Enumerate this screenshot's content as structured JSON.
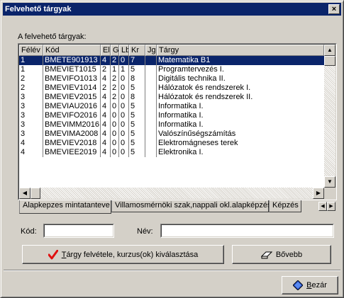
{
  "window": {
    "title": "Felvehető tárgyak",
    "close_glyph": "×"
  },
  "list_label": "A felvehető tárgyak:",
  "table": {
    "columns": [
      "Félév",
      "Kód",
      "El",
      "Gy",
      "Lb",
      "Kr",
      "Jg.",
      "Tárgy"
    ],
    "selected_row": 0,
    "rows": [
      [
        "1",
        "BMETE901913",
        "4",
        "2",
        "0",
        "7",
        "",
        "Matematika B1"
      ],
      [
        "1",
        "BMEVIET1015",
        "2",
        "1",
        "1",
        "5",
        "",
        "Programtervezés I."
      ],
      [
        "2",
        "BMEVIFO1013",
        "4",
        "2",
        "0",
        "8",
        "",
        "Digitális technika II."
      ],
      [
        "2",
        "BMEVIEV1014",
        "2",
        "2",
        "0",
        "5",
        "",
        "Hálózatok és rendszerek I."
      ],
      [
        "3",
        "BMEVIEV2015",
        "4",
        "2",
        "0",
        "8",
        "",
        "Hálózatok és rendszerek II."
      ],
      [
        "3",
        "BMEVIAU2016",
        "4",
        "0",
        "0",
        "5",
        "",
        "Informatika I."
      ],
      [
        "3",
        "BMEVIFO2016",
        "4",
        "0",
        "0",
        "5",
        "",
        "Informatika I."
      ],
      [
        "3",
        "BMEVIMM2016",
        "4",
        "0",
        "0",
        "5",
        "",
        "Informatika I."
      ],
      [
        "3",
        "BMEVIMA2008",
        "4",
        "0",
        "0",
        "5",
        "",
        "Valószínűségszámítás"
      ],
      [
        "4",
        "BMEVIEV2018",
        "4",
        "0",
        "0",
        "5",
        "",
        "Elektromágneses terek"
      ],
      [
        "4",
        "BMEVIEE2019",
        "4",
        "0",
        "0",
        "5",
        "",
        "Elektronika I."
      ]
    ]
  },
  "tabs": [
    "Alapkepzes mintatanteve",
    "Villamosmérnöki szak,nappali okl.alapképzés",
    "Képzés"
  ],
  "active_tab": 0,
  "filters": {
    "kod_label": "Kód:",
    "kod_value": "",
    "nev_label": "Név:",
    "nev_value": ""
  },
  "buttons": {
    "add_label_underlined": "T",
    "add_label_rest": "árgy felvétele, kurzus(ok) kiválasztása",
    "more_label": "Bővebb",
    "close_label_underlined": "B",
    "close_label_rest": "ezár"
  },
  "icons": {
    "add": "red-checkmark-icon",
    "more": "eraser-icon",
    "close": "blue-diamond-icon"
  },
  "colors": {
    "selection": "#0a246a",
    "titlebar": "#0a246a",
    "checkmark": "#e01010",
    "face": "#d4d0c8"
  }
}
